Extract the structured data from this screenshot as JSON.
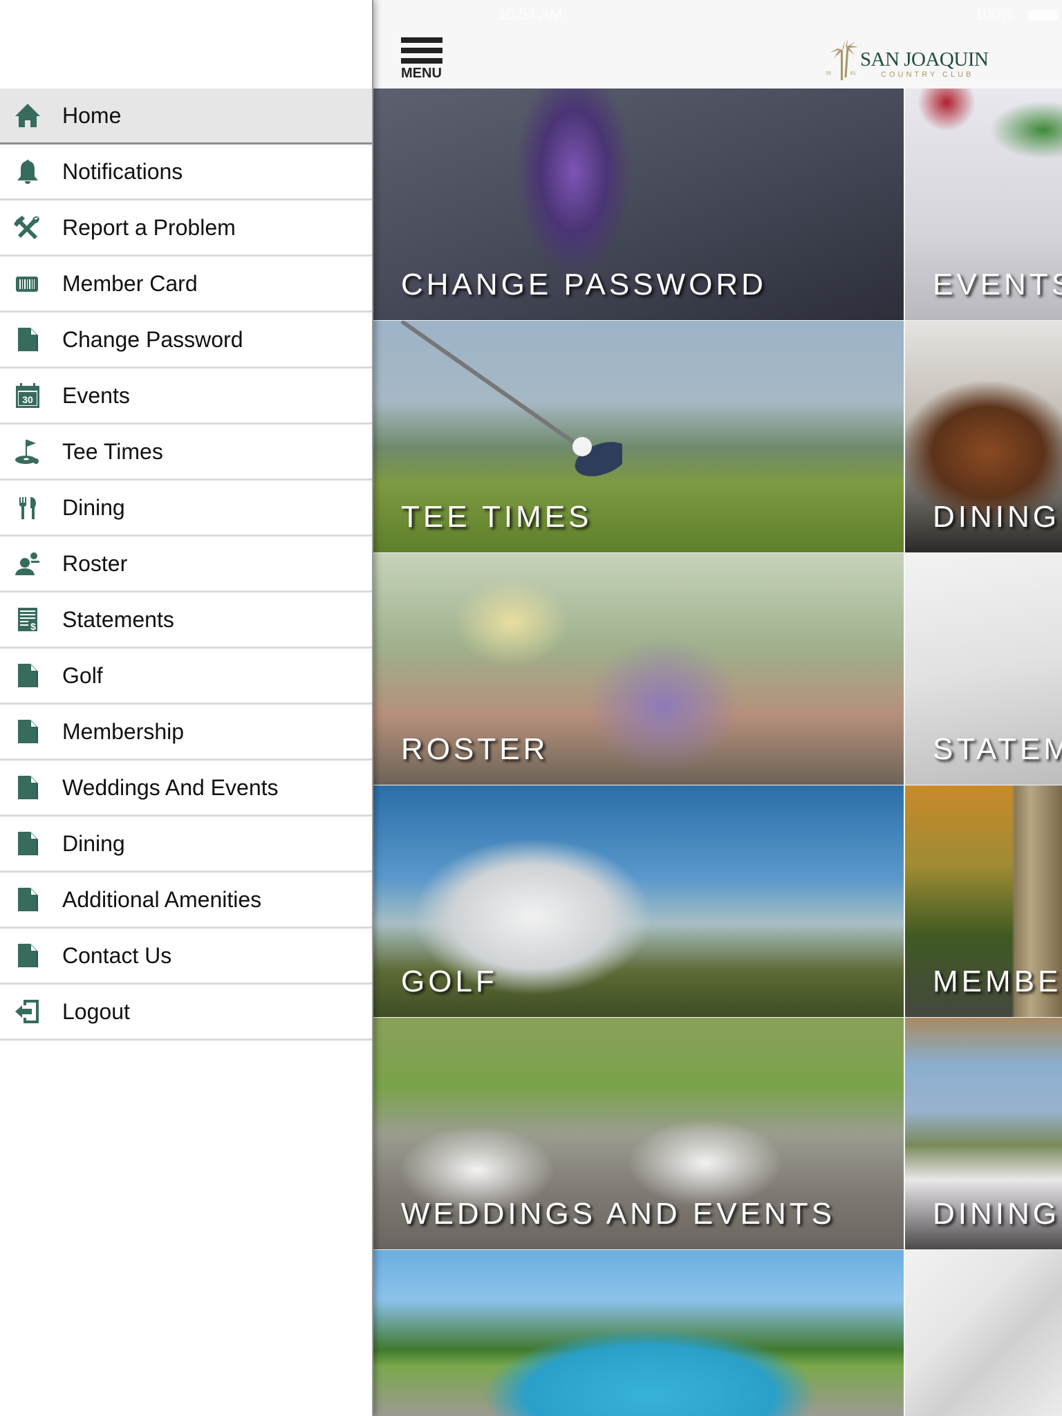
{
  "status_bar": {
    "time": "10:54 AM",
    "battery": "100%"
  },
  "app_bar": {
    "menu_label": "MENU",
    "logo": {
      "name_first": "San",
      "name_second": "Joaquin",
      "subtitle": "COUNTRY CLUB",
      "year_left": "19",
      "year_right": "61"
    }
  },
  "brand": {
    "icon_color": "#376b5e",
    "logo_green": "#1f4d3c",
    "logo_gold": "#a99668"
  },
  "drawer": {
    "items": [
      {
        "label": "Home",
        "icon": "home-icon",
        "active": true
      },
      {
        "label": "Notifications",
        "icon": "bell-icon"
      },
      {
        "label": "Report a Problem",
        "icon": "tools-icon"
      },
      {
        "label": "Member Card",
        "icon": "barcode-card-icon"
      },
      {
        "label": "Change Password",
        "icon": "document-icon"
      },
      {
        "label": "Events",
        "icon": "calendar-icon"
      },
      {
        "label": "Tee Times",
        "icon": "golf-flag-icon"
      },
      {
        "label": "Dining",
        "icon": "fork-knife-icon"
      },
      {
        "label": "Roster",
        "icon": "people-icon"
      },
      {
        "label": "Statements",
        "icon": "statement-icon"
      },
      {
        "label": "Golf",
        "icon": "document-icon"
      },
      {
        "label": "Membership",
        "icon": "document-icon"
      },
      {
        "label": "Weddings And Events",
        "icon": "document-icon"
      },
      {
        "label": "Dining",
        "icon": "document-icon"
      },
      {
        "label": "Additional Amenities",
        "icon": "document-icon"
      },
      {
        "label": "Contact Us",
        "icon": "document-icon"
      },
      {
        "label": "Logout",
        "icon": "logout-icon"
      }
    ]
  },
  "tiles": [
    {
      "label": "CHANGE PASSWORD",
      "image": "hand holding smartphone"
    },
    {
      "label": "EVENTS",
      "image": "table setting with flowers"
    },
    {
      "label": "TEE TIMES",
      "image": "golf driver and ball on grass"
    },
    {
      "label": "DINING",
      "image": "plated entree"
    },
    {
      "label": "ROSTER",
      "image": "smiling golfers"
    },
    {
      "label": "STATEMENTS",
      "image": "statement document"
    },
    {
      "label": "GOLF",
      "image": "golf cart on hillside"
    },
    {
      "label": "MEMBERSHIP",
      "image": "club entrance gate"
    },
    {
      "label": "WEDDINGS AND EVENTS",
      "image": "outdoor patio tables"
    },
    {
      "label": "DINING",
      "image": "dining room with windows"
    },
    {
      "label": "",
      "image": "pool with umbrellas"
    },
    {
      "label": "",
      "image": "abstract light background"
    }
  ]
}
